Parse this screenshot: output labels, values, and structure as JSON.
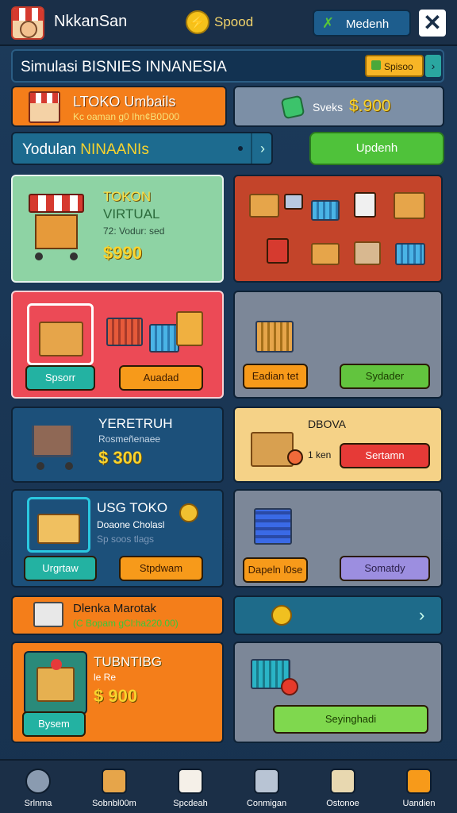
{
  "header": {
    "username": "NkkanSan",
    "coin_symbol": "⚡",
    "coin_label": "Spood",
    "menu_label": "Medenh",
    "close_symbol": "✕"
  },
  "title_bar": {
    "title": "Simulasi BISNIES INNANESIA",
    "pill_label": "Spisoo",
    "arrow": "›"
  },
  "store": {
    "name": "LTOKO Umbails",
    "subtitle": "Kc oaman g0 Ihn¢B0D00"
  },
  "balance": {
    "label": "Sveks",
    "value": "$.900"
  },
  "banner": {
    "text_plain": "Yodulan",
    "text_highlight": "NINAANIs",
    "chevron": "›"
  },
  "update_button": "Updenh",
  "cards": {
    "c1": {
      "title": "TOKON",
      "subtitle": "VIRTUAL",
      "note": "72: Vodur: sed",
      "price": "$990"
    },
    "c3": {
      "left_button": "Spsorr",
      "right_button": "Auadad"
    },
    "c4": {
      "left_button": "Eadian tet",
      "right_button": "Sydader"
    },
    "c5": {
      "title": "YERETRUH",
      "subtitle": "Rosmeñenaee",
      "price": "$ 300"
    },
    "c6": {
      "title": "DBOVA",
      "subtitle": "1 ken",
      "button": "Sertamn"
    },
    "c7": {
      "title": "USG TOKO",
      "subtitle": "Doaone Cholasl",
      "note": "Sp soos tlags",
      "left_button": "Urgrtaw",
      "right_button": "Stpdwam"
    },
    "c8": {
      "left_button": "Dapeln l0se",
      "right_button": "Somatdy"
    },
    "c9": {
      "title": "Dlenka Marotak",
      "subtitle": "(C Bopam gCl:ha220.00)"
    },
    "c10": {
      "chevron": "›"
    },
    "c11": {
      "title": "TUBNTIBG",
      "subtitle": "le Re",
      "price": "$ 900",
      "button": "Bysem"
    },
    "c12": {
      "button": "Seyinghadi"
    }
  },
  "bottom_nav": [
    {
      "label": "Srlnma",
      "icon": "duck-icon",
      "color": "#8a9bb0"
    },
    {
      "label": "Sobnbl00m",
      "icon": "store-icon",
      "color": "#e6a54a"
    },
    {
      "label": "Spcdeah",
      "icon": "box-icon",
      "color": "#f5f0e8"
    },
    {
      "label": "Conmigan",
      "icon": "grid-icon",
      "color": "#b8c4d4"
    },
    {
      "label": "Ostonoe",
      "icon": "shopping-icon",
      "color": "#e8d8b0"
    },
    {
      "label": "Uandien",
      "icon": "chest-icon",
      "color": "#f79a1a"
    }
  ]
}
